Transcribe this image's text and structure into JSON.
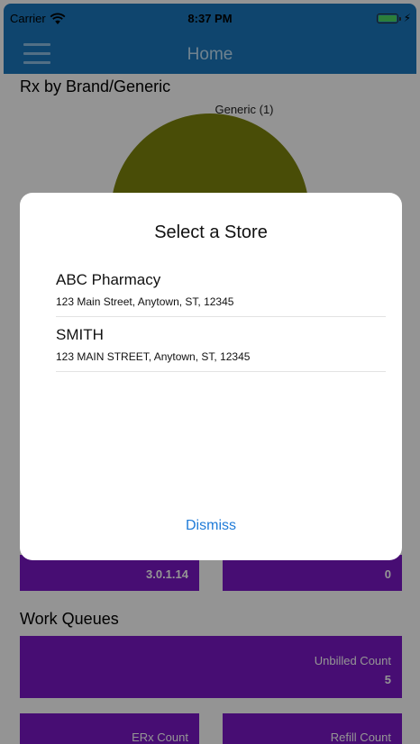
{
  "status_bar": {
    "carrier": "Carrier",
    "time": "8:37 PM"
  },
  "nav": {
    "title": "Home",
    "menu_icon": "hamburger-menu-icon"
  },
  "brand_generic": {
    "section_title": "Rx by Brand/Generic",
    "pie_label": "Generic (1)",
    "pie_color": "#7f860d"
  },
  "info_tiles": [
    {
      "value": "3.0.1.14"
    },
    {
      "value": "0"
    }
  ],
  "work_queues": {
    "section_title": "Work Queues",
    "tiles": [
      {
        "label": "Unbilled Count",
        "value": "5"
      },
      {
        "label": "ERx Count"
      },
      {
        "label": "Refill Count"
      }
    ]
  },
  "dialog": {
    "title": "Select a Store",
    "stores": [
      {
        "name": "ABC Pharmacy",
        "address": "123 Main Street, Anytown, ST, 12345"
      },
      {
        "name": "SMITH",
        "address": "123 MAIN STREET, Anytown, ST, 12345"
      }
    ],
    "dismiss_label": "Dismiss"
  },
  "colors": {
    "nav": "#1a78be",
    "tile": "#7b18c7",
    "link": "#1f7bd8",
    "battery": "#4cd964"
  }
}
